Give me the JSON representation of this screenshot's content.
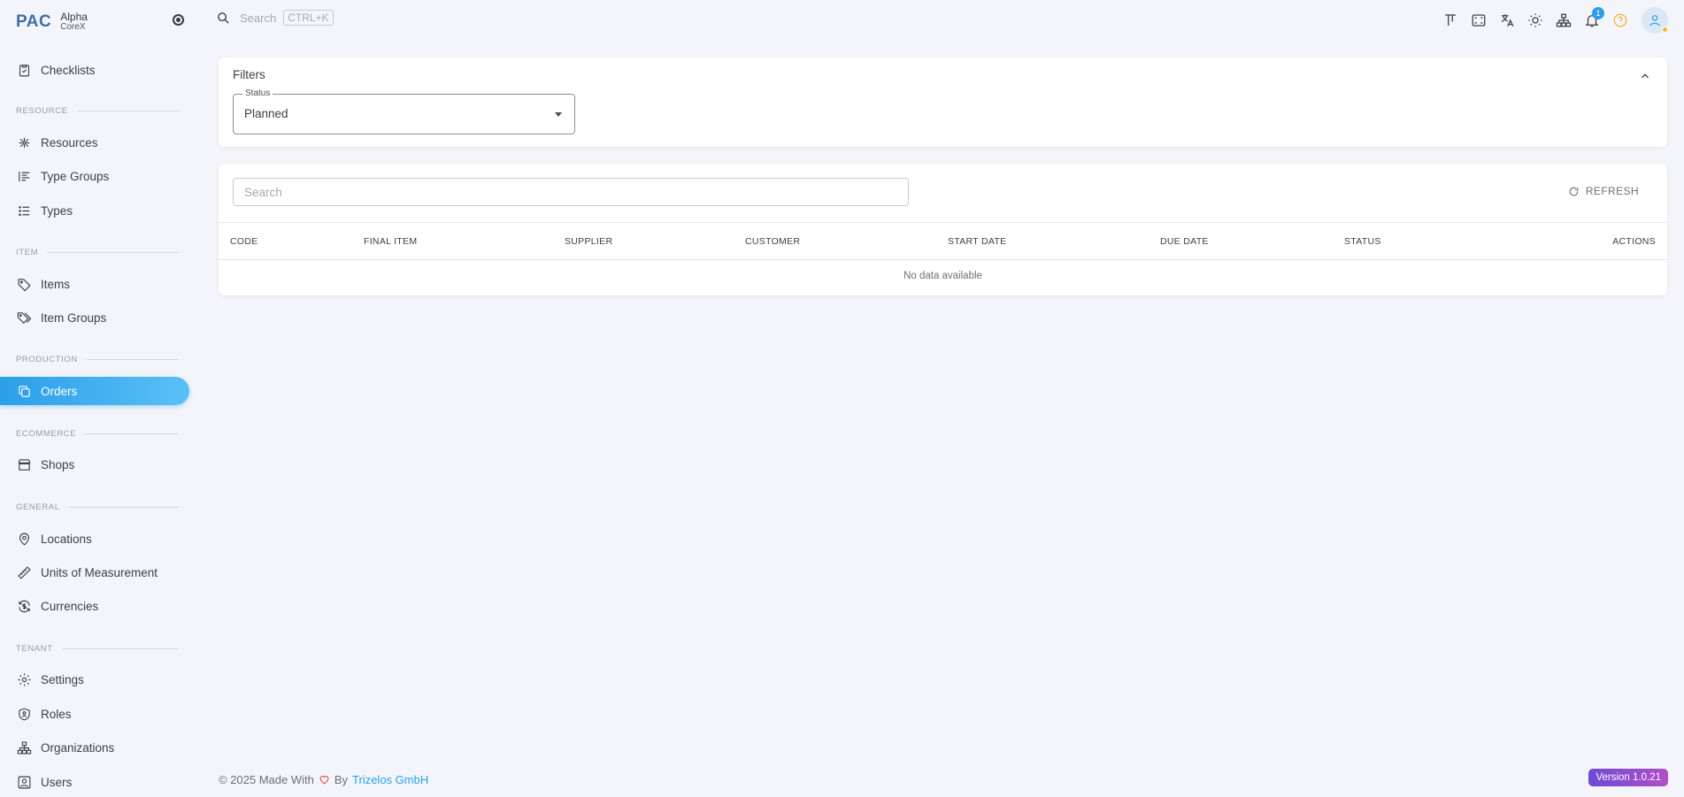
{
  "brand": {
    "logo": "PAC",
    "title": "Alpha",
    "subtitle": "CoreX"
  },
  "topbar": {
    "search_label": "Search",
    "search_shortcut": "CTRL+K",
    "notification_count": "1"
  },
  "sidebar": {
    "checklists": "Checklists",
    "sections": {
      "resource": "RESOURCE",
      "item": "ITEM",
      "production": "PRODUCTION",
      "ecommerce": "ECOMMERCE",
      "general": "GENERAL",
      "tenant": "TENANT"
    },
    "items": {
      "resources": "Resources",
      "type_groups": "Type Groups",
      "types": "Types",
      "items": "Items",
      "item_groups": "Item Groups",
      "orders": "Orders",
      "shops": "Shops",
      "locations": "Locations",
      "units": "Units of Measurement",
      "currencies": "Currencies",
      "settings": "Settings",
      "roles": "Roles",
      "organizations": "Organizations",
      "users": "Users"
    }
  },
  "filters": {
    "title": "Filters",
    "status_label": "Status",
    "status_value": "Planned"
  },
  "table": {
    "search_placeholder": "Search",
    "refresh_label": "REFRESH",
    "columns": [
      "CODE",
      "FINAL ITEM",
      "SUPPLIER",
      "CUSTOMER",
      "START DATE",
      "DUE DATE",
      "STATUS",
      "ACTIONS"
    ],
    "empty_text": "No data available"
  },
  "footer": {
    "prefix": "© 2025 Made With",
    "by": "By",
    "company": "Trizelos GmbH",
    "version": "Version 1.0.21"
  },
  "colors": {
    "accent": "#2b9fe8",
    "version_badge": "#8a4dd0",
    "heart": "#e64a4a"
  }
}
